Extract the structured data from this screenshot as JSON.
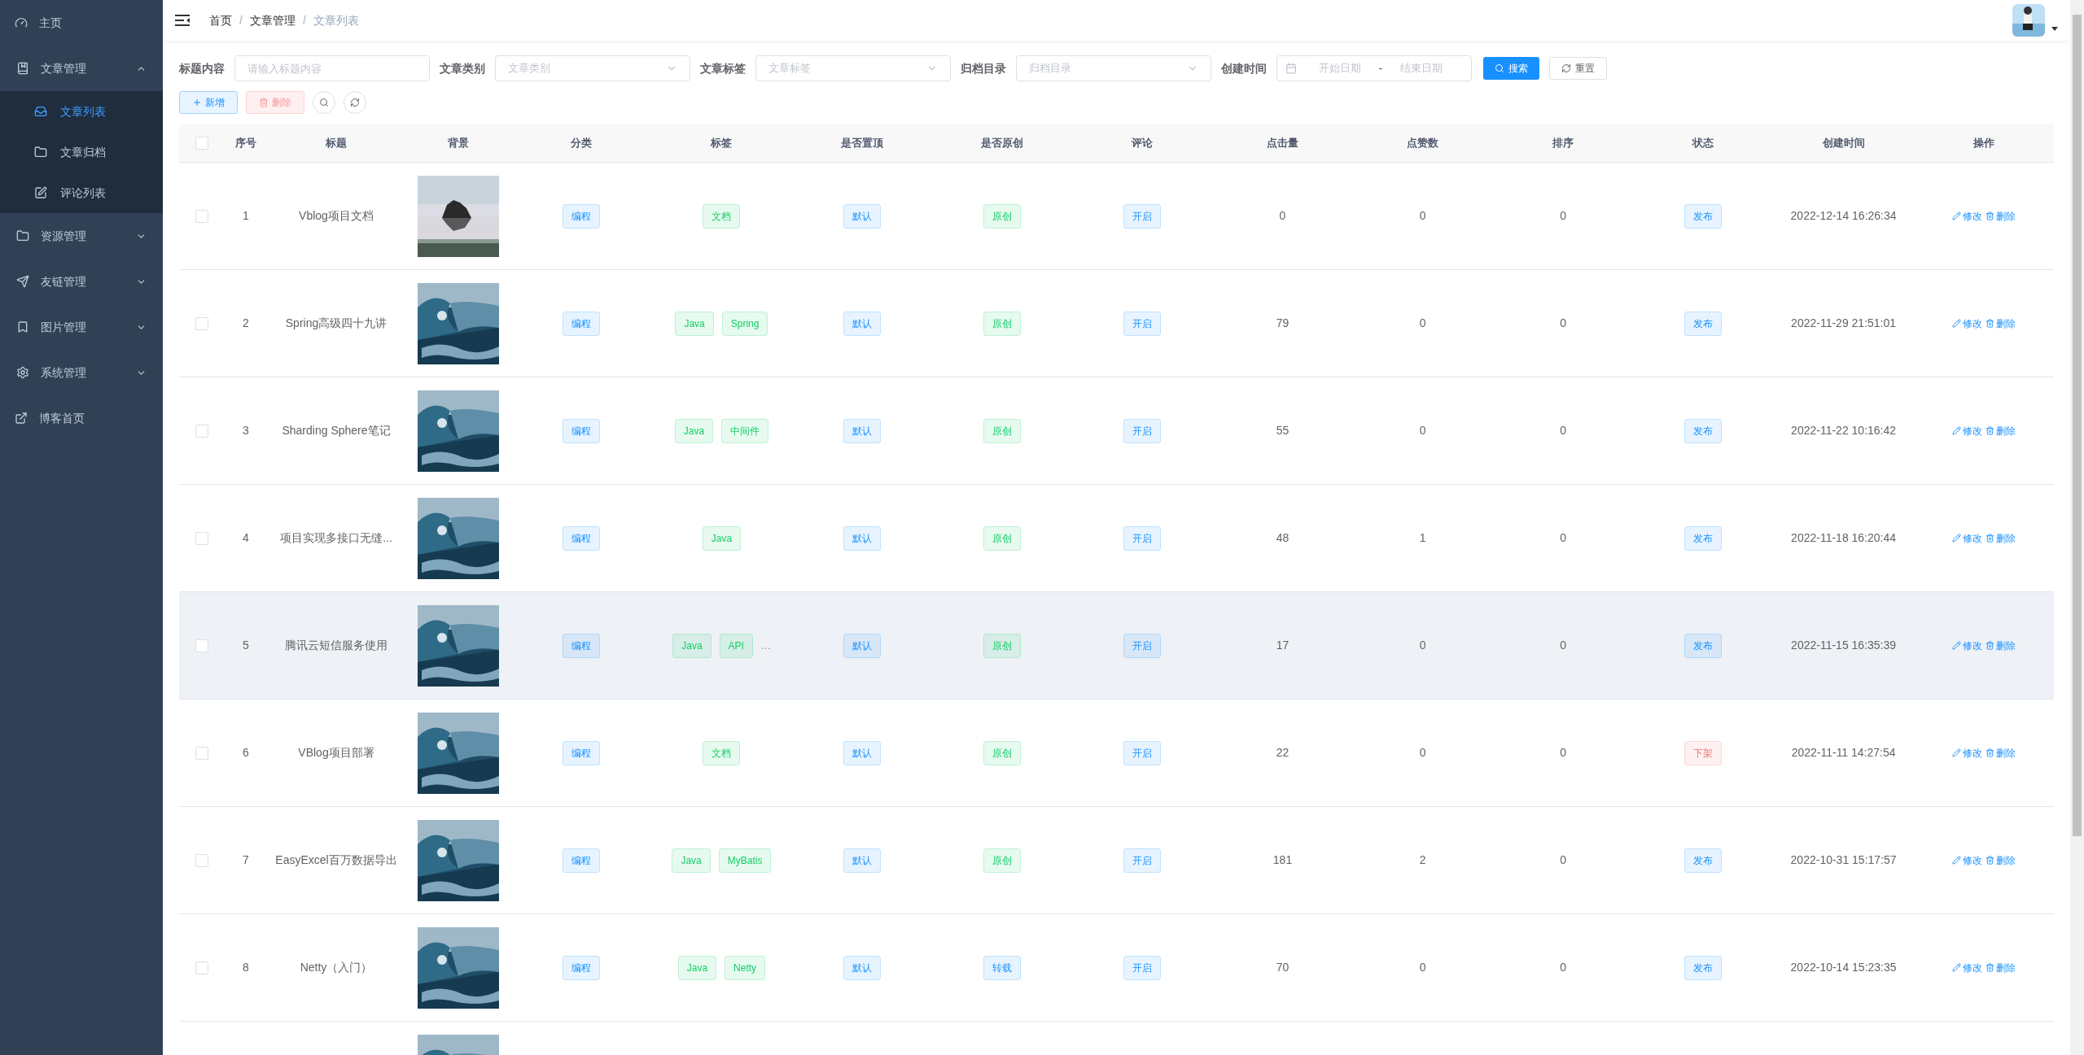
{
  "sidebar": {
    "items": [
      {
        "label": "主页",
        "kind": "link"
      },
      {
        "label": "文章管理",
        "kind": "group",
        "expanded": true,
        "children": [
          {
            "label": "文章列表",
            "selected": true
          },
          {
            "label": "文章归档",
            "selected": false
          },
          {
            "label": "评论列表",
            "selected": false
          }
        ]
      },
      {
        "label": "资源管理",
        "kind": "group",
        "expanded": false
      },
      {
        "label": "友链管理",
        "kind": "group",
        "expanded": false
      },
      {
        "label": "图片管理",
        "kind": "group",
        "expanded": false
      },
      {
        "label": "系统管理",
        "kind": "group",
        "expanded": false
      },
      {
        "label": "博客首页",
        "kind": "link"
      }
    ]
  },
  "breadcrumb": [
    "首页",
    "文章管理",
    "文章列表"
  ],
  "breadcrumb_separator": "/",
  "avatar": {
    "kind": "picture"
  },
  "filters": [
    {
      "label": "标题内容",
      "kind": "input",
      "placeholder": "请输入标题内容"
    },
    {
      "label": "文章类别",
      "kind": "select",
      "placeholder": "文章类别"
    },
    {
      "label": "文章标签",
      "kind": "select",
      "placeholder": "文章标签"
    },
    {
      "label": "归档目录",
      "kind": "select",
      "placeholder": "归档目录"
    },
    {
      "label": "创建时间",
      "kind": "daterange",
      "start_placeholder": "开始日期",
      "separator": "-",
      "end_placeholder": "结束日期"
    }
  ],
  "search_button": "搜索",
  "reset_button": "重置",
  "toolbar": {
    "add_button": "新增",
    "delete_button": "删除"
  },
  "table": {
    "header_checked": false,
    "columns": [
      "序号",
      "标题",
      "背景",
      "分类",
      "标签",
      "是否置顶",
      "是否原创",
      "评论",
      "点击量",
      "点赞数",
      "排序",
      "状态",
      "创建时间",
      "操作"
    ],
    "rows": [
      {
        "checked": false,
        "hovered": false,
        "index": "1",
        "title": "Vblog项目文档",
        "background": {
          "kind": "picture"
        },
        "category": "编程",
        "tags": [
          "文档"
        ],
        "top": "默认",
        "original": {
          "text": "原创",
          "kind": "success"
        },
        "comment": "开启",
        "views": "0",
        "likes": "0",
        "sort": "0",
        "status": {
          "text": "发布",
          "color": "#1890ff"
        },
        "created": "2022-12-14 16:26:34",
        "edit": "修改",
        "delete": "删除"
      },
      {
        "checked": false,
        "hovered": false,
        "index": "2",
        "title": "Spring高级四十九讲",
        "background": {
          "kind": "picture"
        },
        "category": "编程",
        "tags": [
          "Java",
          "Spring"
        ],
        "top": "默认",
        "original": {
          "text": "原创",
          "kind": "success"
        },
        "comment": "开启",
        "views": "79",
        "likes": "0",
        "sort": "0",
        "status": {
          "text": "发布",
          "color": "#1890ff"
        },
        "created": "2022-11-29 21:51:01",
        "edit": "修改",
        "delete": "删除"
      },
      {
        "checked": false,
        "hovered": false,
        "index": "3",
        "title": "Sharding Sphere笔记",
        "background": {
          "kind": "picture"
        },
        "category": "编程",
        "tags": [
          "Java",
          "中间件"
        ],
        "top": "默认",
        "original": {
          "text": "原创",
          "kind": "success"
        },
        "comment": "开启",
        "views": "55",
        "likes": "0",
        "sort": "0",
        "status": {
          "text": "发布",
          "color": "#1890ff"
        },
        "created": "2022-11-22 10:16:42",
        "edit": "修改",
        "delete": "删除"
      },
      {
        "checked": false,
        "hovered": false,
        "index": "4",
        "title": "项目实现多接口无缝...",
        "background": {
          "kind": "picture"
        },
        "category": "编程",
        "tags": [
          "Java"
        ],
        "top": "默认",
        "original": {
          "text": "原创",
          "kind": "success"
        },
        "comment": "开启",
        "views": "48",
        "likes": "1",
        "sort": "0",
        "status": {
          "text": "发布",
          "color": "#1890ff"
        },
        "created": "2022-11-18 16:20:44",
        "edit": "修改",
        "delete": "删除"
      },
      {
        "checked": false,
        "hovered": true,
        "index": "5",
        "title": "腾讯云短信服务使用",
        "background": {
          "kind": "picture"
        },
        "category": "编程",
        "tags": [
          "Java",
          "API"
        ],
        "tags_more": "...",
        "top": "默认",
        "original": {
          "text": "原创",
          "kind": "success"
        },
        "comment": "开启",
        "views": "17",
        "likes": "0",
        "sort": "0",
        "status": {
          "text": "发布",
          "color": "#1890ff"
        },
        "created": "2022-11-15 16:35:39",
        "edit": "修改",
        "delete": "删除"
      },
      {
        "checked": false,
        "hovered": false,
        "index": "6",
        "title": "VBlog项目部署",
        "background": {
          "kind": "picture"
        },
        "category": "编程",
        "tags": [
          "文档"
        ],
        "top": "默认",
        "original": {
          "text": "原创",
          "kind": "success"
        },
        "comment": "开启",
        "views": "22",
        "likes": "0",
        "sort": "0",
        "status": {
          "text": "下架",
          "color": "#f56c6c"
        },
        "created": "2022-11-11 14:27:54",
        "edit": "修改",
        "delete": "删除"
      },
      {
        "checked": false,
        "hovered": false,
        "index": "7",
        "title": "EasyExcel百万数据导出",
        "background": {
          "kind": "picture"
        },
        "category": "编程",
        "tags": [
          "Java",
          "MyBatis"
        ],
        "top": "默认",
        "original": {
          "text": "原创",
          "kind": "success"
        },
        "comment": "开启",
        "views": "181",
        "likes": "2",
        "sort": "0",
        "status": {
          "text": "发布",
          "color": "#1890ff"
        },
        "created": "2022-10-31 15:17:57",
        "edit": "修改",
        "delete": "删除"
      },
      {
        "checked": false,
        "hovered": false,
        "index": "8",
        "title": "Netty（入门）",
        "background": {
          "kind": "picture"
        },
        "category": "编程",
        "tags": [
          "Java",
          "Netty"
        ],
        "top": "默认",
        "original": {
          "text": "转载",
          "kind": "primary"
        },
        "comment": "开启",
        "views": "70",
        "likes": "0",
        "sort": "0",
        "status": {
          "text": "发布",
          "color": "#1890ff"
        },
        "created": "2022-10-14 15:23:35",
        "edit": "修改",
        "delete": "删除"
      },
      {
        "background": {
          "kind": "picture"
        }
      }
    ]
  }
}
